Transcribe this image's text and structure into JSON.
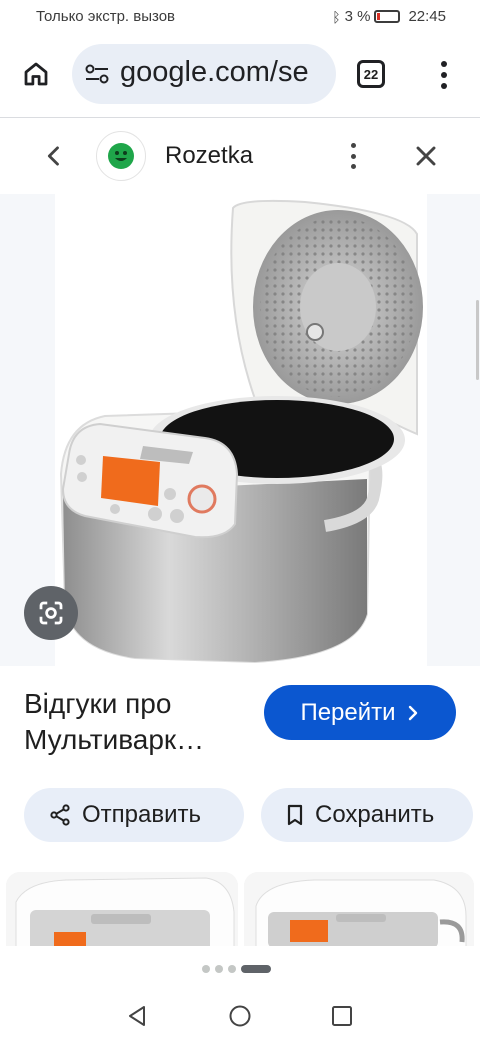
{
  "status_bar": {
    "carrier_text": "Только экстр. вызов",
    "battery_percent": "3 %",
    "time": "22:45"
  },
  "browser": {
    "url": "google.com/se",
    "tab_count": "22",
    "icons": [
      "home-icon",
      "tune-icon",
      "tabs-icon",
      "more-vert-icon"
    ]
  },
  "source": {
    "name": "Rozetka",
    "logo_color": "#1fa64a"
  },
  "result": {
    "title_line1": "Відгуки про",
    "title_line2": "Мультиварк…",
    "go_label": "Перейти",
    "share_label": "Отправить",
    "save_label": "Сохранить"
  },
  "colors": {
    "accent": "#0b57d0",
    "pill_bg": "#e8eef8"
  },
  "pager": {
    "count": 4,
    "active_index": 3
  }
}
